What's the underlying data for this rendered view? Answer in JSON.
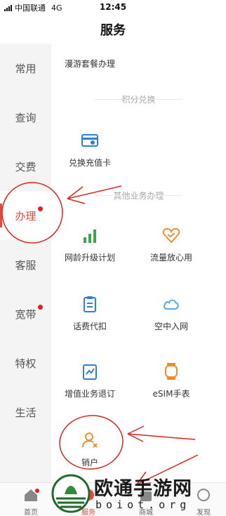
{
  "status_bar": {
    "carrier": "中国联通",
    "network": "4G",
    "time": "12:45"
  },
  "header": {
    "title": "服务"
  },
  "sidebar": {
    "items": [
      {
        "label": "常用",
        "dot": false,
        "active": false
      },
      {
        "label": "查询",
        "dot": false,
        "active": false
      },
      {
        "label": "交费",
        "dot": false,
        "active": false
      },
      {
        "label": "办理",
        "dot": true,
        "active": true
      },
      {
        "label": "客服",
        "dot": false,
        "active": false
      },
      {
        "label": "宽带",
        "dot": true,
        "active": false
      },
      {
        "label": "特权",
        "dot": false,
        "active": false
      },
      {
        "label": "生活",
        "dot": false,
        "active": false
      }
    ]
  },
  "content": {
    "roaming_label": "漫游套餐办理",
    "sections": {
      "points_exchange": "积分兑换",
      "other_business": "其他业务办理"
    },
    "items": {
      "recharge_card": "兑换充值卡",
      "network_age_upgrade": "网龄升级计划",
      "data_assurance": "流量放心用",
      "fee_deduction": "话费代扣",
      "sky_internet": "空中入网",
      "value_added_unsubscribe": "增值业务退订",
      "esim_watch": "eSIM手表",
      "cancel_account": "销户"
    }
  },
  "tabbar": {
    "items": [
      {
        "label": "首页",
        "active": false,
        "dot": true
      },
      {
        "label": "服务",
        "active": true,
        "dot": false
      },
      {
        "label": "商城",
        "active": false,
        "dot": false
      },
      {
        "label": "发现",
        "active": false,
        "dot": false
      }
    ]
  },
  "watermark": {
    "text": "欧通手游网",
    "sub": "boiot.org"
  },
  "colors": {
    "accent": "#e8473b",
    "annotation_red": "#d9251d",
    "icon_blue": "#2d7fd9",
    "icon_green": "#3aa84a",
    "icon_orange": "#f08c2e"
  }
}
